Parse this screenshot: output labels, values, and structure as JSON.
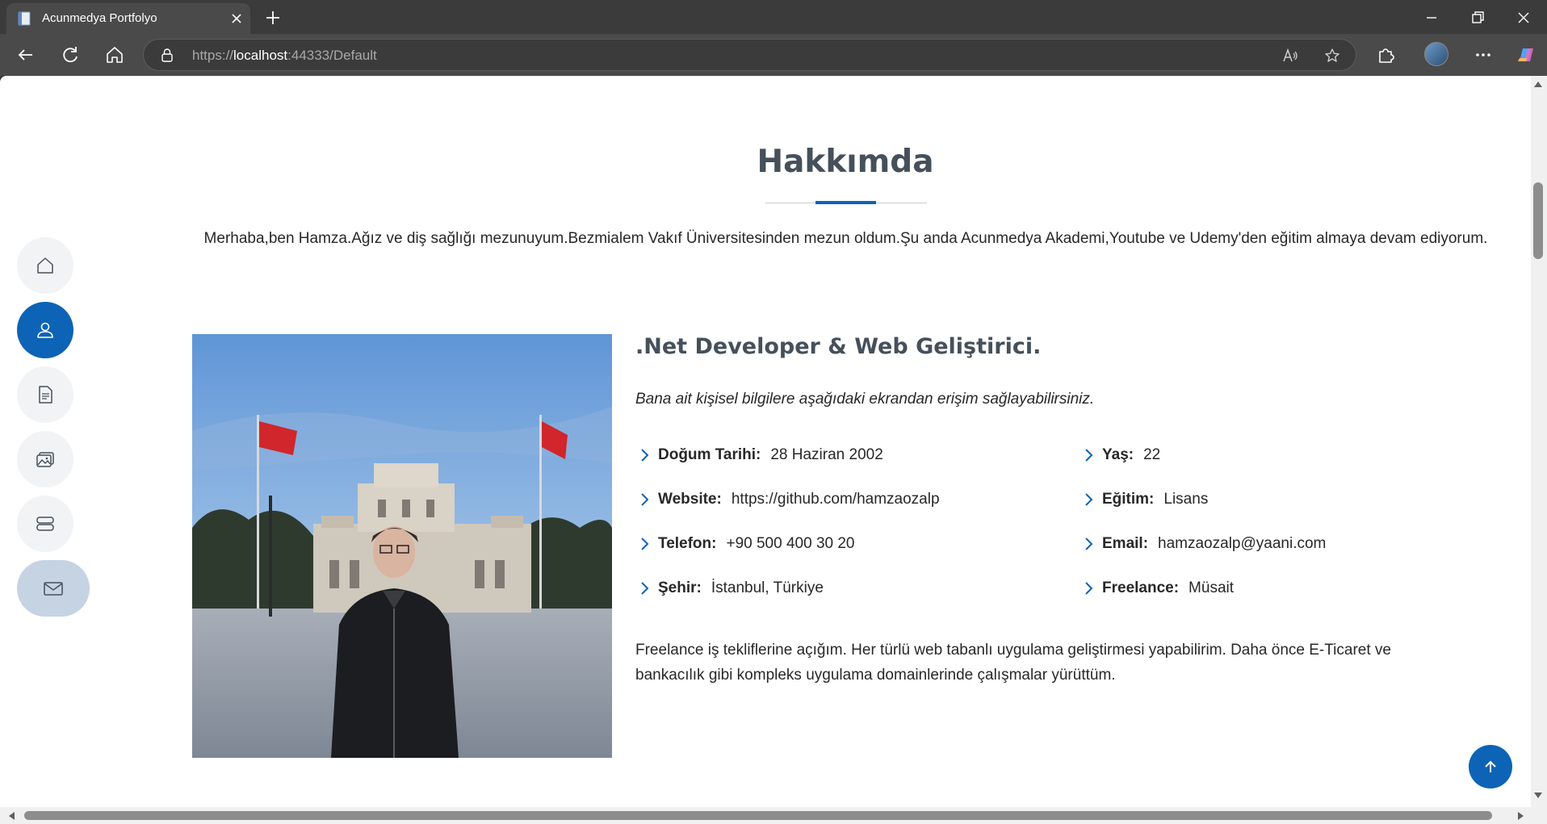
{
  "browser": {
    "tab_title": "Acunmedya Portfolyo",
    "url_scheme": "https://",
    "url_host": "localhost",
    "url_rest": ":44333/Default"
  },
  "about": {
    "title": "Hakkımda",
    "intro": "Merhaba,ben Hamza.Ağız ve diş sağlığı mezunuyum.Bezmialem Vakıf Üniversitesinden mezun oldum.Şu anda Acunmedya Akademi,Youtube ve Udemy'den eğitim almaya devam ediyorum.",
    "role": ".Net Developer & Web Geliştirici.",
    "lead": "Bana ait kişisel bilgilere aşağıdaki ekrandan erişim sağlayabilirsiniz.",
    "left_info": [
      {
        "label": "Doğum Tarihi:",
        "value": "28 Haziran 2002"
      },
      {
        "label": "Website:",
        "value": "https://github.com/hamzaozalp"
      },
      {
        "label": "Telefon:",
        "value": "+90 500 400 30 20"
      },
      {
        "label": "Şehir:",
        "value": "İstanbul, Türkiye"
      }
    ],
    "right_info": [
      {
        "label": "Yaş:",
        "value": "22"
      },
      {
        "label": "Eğitim:",
        "value": "Lisans"
      },
      {
        "label": "Email:",
        "value": "hamzaozalp@yaani.com"
      },
      {
        "label": "Freelance:",
        "value": "Müsait"
      }
    ],
    "freelance_text": "Freelance iş tekliflerine açığım. Her türlü web tabanlı uygulama geliştirmesi yapabilirim. Daha önce E-Ticaret ve bankacılık gibi kompleks uygulama domainlerinde çalışmalar yürüttüm."
  },
  "side_nav": {
    "items": [
      "home-icon",
      "person-icon",
      "document-icon",
      "images-icon",
      "server-icon",
      "envelope-icon"
    ],
    "active": "person-icon"
  },
  "colors": {
    "accent": "#0d63b5",
    "heading": "#45505b",
    "text": "#272829"
  }
}
